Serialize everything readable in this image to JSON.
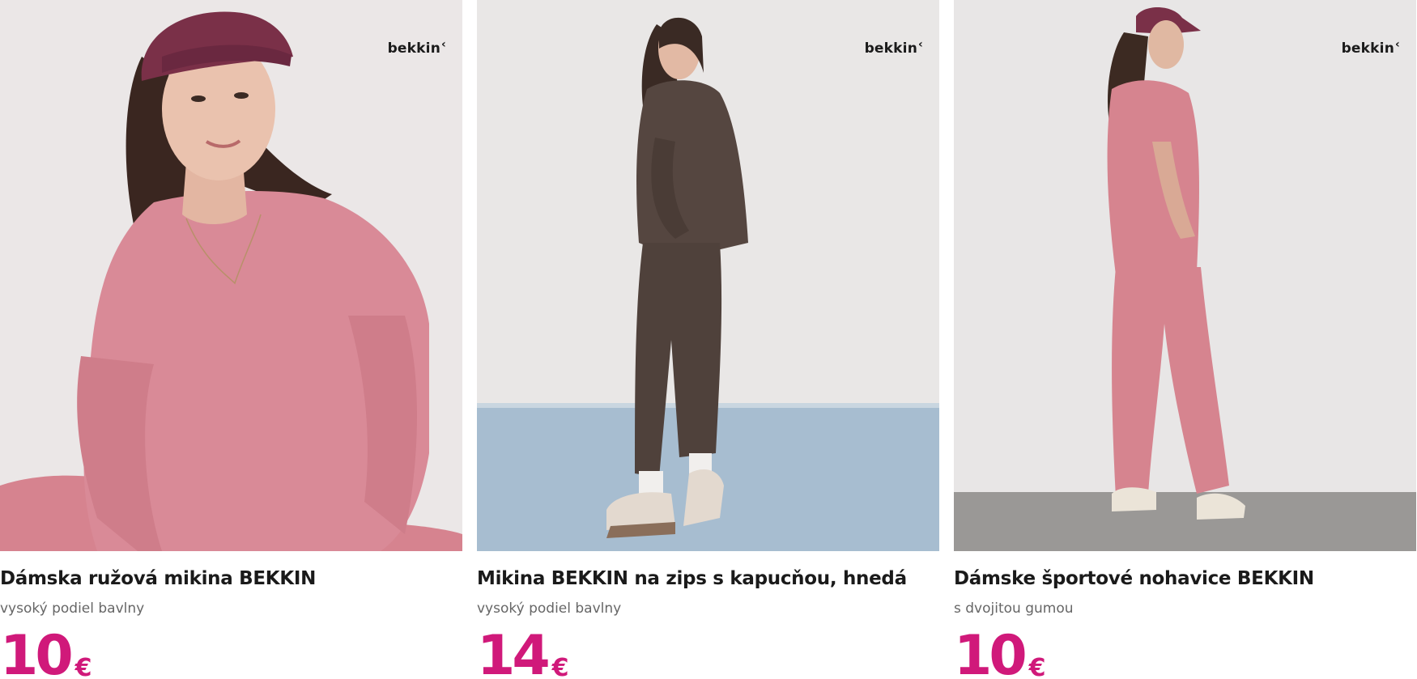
{
  "brand": {
    "logo_text": "bekkin",
    "logo_mark": "‹"
  },
  "colors": {
    "price": "#d0197a",
    "title": "#1a1a1a",
    "subtitle": "#666666"
  },
  "products": [
    {
      "title": "Dámska ružová mikina BEKKIN",
      "subtitle": "vysoký podiel bavlny",
      "price": "10",
      "currency": "€",
      "image": "woman-pink-sweatshirt-cap"
    },
    {
      "title": "Mikina BEKKIN na zips s kapucňou, hnedá",
      "subtitle": "vysoký podiel bavlny",
      "price": "14",
      "currency": "€",
      "image": "woman-brown-hoodie-joggers"
    },
    {
      "title": "Dámske športové nohavice BEKKIN",
      "subtitle": "s dvojitou gumou",
      "price": "10",
      "currency": "€",
      "image": "woman-pink-tshirt-joggers"
    }
  ]
}
